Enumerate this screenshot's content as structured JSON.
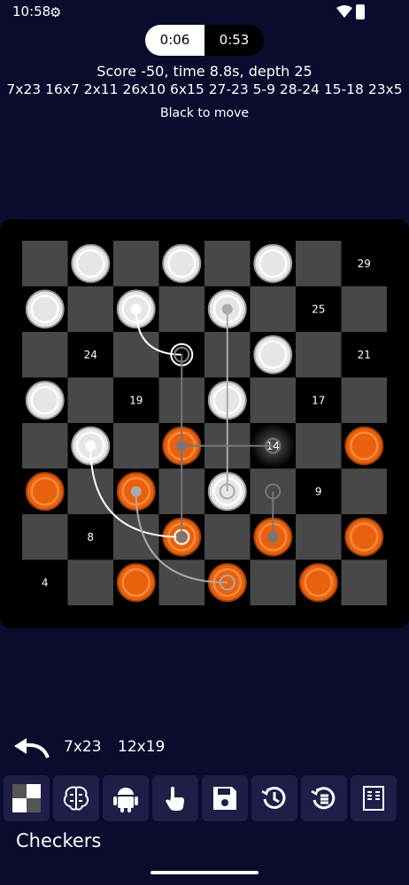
{
  "status": {
    "time": "10:58"
  },
  "clocks": {
    "white": "0:06",
    "black": "0:53"
  },
  "engine": {
    "score": "Score -50, time 8.8s, depth 25",
    "pv": "7x23 16x7 2x11 26x10 6x15 27-23 5-9 28-24 15-18 23x5",
    "to_move": "Black to move"
  },
  "board": {
    "light_square": "#484848",
    "dark_square": "#000000",
    "white_piece": "#e6e6e6",
    "black_piece": "#e8610e",
    "white_pieces": [
      [
        0,
        1
      ],
      [
        0,
        3
      ],
      [
        0,
        5
      ],
      [
        1,
        0
      ],
      [
        1,
        2
      ],
      [
        1,
        4
      ],
      [
        2,
        5
      ],
      [
        3,
        0
      ],
      [
        3,
        4
      ],
      [
        4,
        1
      ],
      [
        5,
        4
      ]
    ],
    "black_pieces": [
      [
        4,
        3
      ],
      [
        4,
        7
      ],
      [
        5,
        0
      ],
      [
        5,
        2
      ],
      [
        6,
        3
      ],
      [
        6,
        5
      ],
      [
        6,
        7
      ],
      [
        7,
        2
      ],
      [
        7,
        4
      ],
      [
        7,
        6
      ]
    ],
    "highlight_square": [
      4,
      5
    ],
    "capture_marker": [
      2,
      3
    ],
    "square_numbers": [
      {
        "sq": [
          0,
          7
        ],
        "label": "29"
      },
      {
        "sq": [
          1,
          6
        ],
        "label": "25"
      },
      {
        "sq": [
          2,
          1
        ],
        "label": "24"
      },
      {
        "sq": [
          2,
          7
        ],
        "label": "21"
      },
      {
        "sq": [
          3,
          2
        ],
        "label": "19"
      },
      {
        "sq": [
          3,
          6
        ],
        "label": "17"
      },
      {
        "sq": [
          4,
          5
        ],
        "label": "14"
      },
      {
        "sq": [
          5,
          6
        ],
        "label": "9"
      },
      {
        "sq": [
          6,
          1
        ],
        "label": "8"
      },
      {
        "sq": [
          7,
          0
        ],
        "label": "4"
      }
    ],
    "arrows": [
      {
        "from": [
          1,
          2
        ],
        "to": [
          2,
          3
        ],
        "color": "#ffffff"
      },
      {
        "from": [
          4,
          1
        ],
        "to": [
          6,
          3
        ],
        "color": "#ffffff"
      },
      {
        "from": [
          1,
          4
        ],
        "to": [
          5,
          4
        ],
        "color": "#aaaaaa"
      },
      {
        "from": [
          5,
          2
        ],
        "to": [
          7,
          4
        ],
        "color": "#aaaaaa"
      },
      {
        "from": [
          6,
          3
        ],
        "to": [
          2,
          3
        ],
        "color": "#777777"
      },
      {
        "from": [
          4,
          3
        ],
        "to": [
          4,
          5
        ],
        "color": "#777777"
      },
      {
        "from": [
          6,
          5
        ],
        "to": [
          5,
          5
        ],
        "color": "#777777"
      }
    ]
  },
  "moves": {
    "first": "7x23",
    "second": "12x19"
  },
  "toolbar": [
    "board-icon",
    "brain-icon",
    "android-icon",
    "hand-icon",
    "save-icon",
    "history-icon",
    "restore-icon",
    "book-icon"
  ],
  "app": {
    "title": "Checkers"
  }
}
